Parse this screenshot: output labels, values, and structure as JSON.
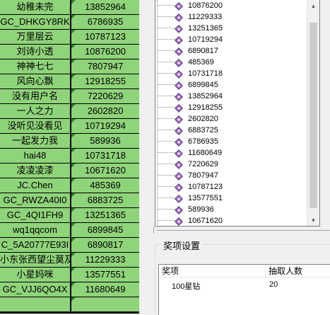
{
  "grid": {
    "rows": [
      {
        "name": "幼稚未完",
        "num": "13852964"
      },
      {
        "name": "GC_DHKGY8RK",
        "num": "6786935"
      },
      {
        "name": "万里层云",
        "num": "10787123"
      },
      {
        "name": "刘诗小透",
        "num": "10876200"
      },
      {
        "name": "神神七七",
        "num": "7807947"
      },
      {
        "name": "风向心飘",
        "num": "12918255"
      },
      {
        "name": "没有用户名",
        "num": "7220629"
      },
      {
        "name": "一人之力",
        "num": "2602820"
      },
      {
        "name": "没听见没看见",
        "num": "10719294"
      },
      {
        "name": "一起发力我",
        "num": "589936"
      },
      {
        "name": "hai48",
        "num": "10731718"
      },
      {
        "name": "凌凌凌漆",
        "num": "10671620"
      },
      {
        "name": "JC.Chen",
        "num": "485369"
      },
      {
        "name": "GC_RWZA40I0",
        "num": "6883725"
      },
      {
        "name": "GC_4QI1FH9",
        "num": "13251365"
      },
      {
        "name": "wq1qqcom",
        "num": "6899845"
      },
      {
        "name": "C_5A20777E93I",
        "num": "6890817"
      },
      {
        "name": "小东张西望尘莫及",
        "num": "11229333"
      },
      {
        "name": "小星妈咪",
        "num": "13577551"
      },
      {
        "name": "GC_VJJ6QO4X",
        "num": "11680649"
      },
      {
        "name": "",
        "num": ""
      }
    ]
  },
  "tree": {
    "items": [
      "10876200",
      "11229333",
      "13251365",
      "10719294",
      "6890817",
      "485369",
      "10731718",
      "6899845",
      "13852964",
      "12918255",
      "2602820",
      "6883725",
      "6786935",
      "11680649",
      "7220629",
      "7807947",
      "10787123",
      "13577551",
      "589936",
      "10671620"
    ],
    "icon": "gem-icon"
  },
  "prize": {
    "group_title": "奖项设置",
    "columns": [
      "奖项",
      "抽取人数"
    ],
    "rows": [
      {
        "name": "100星钻",
        "count": "20"
      }
    ]
  },
  "colors": {
    "cell_bg": "#8fd37a",
    "grid_line": "#000000",
    "corner_mark": "#2e7d32"
  }
}
